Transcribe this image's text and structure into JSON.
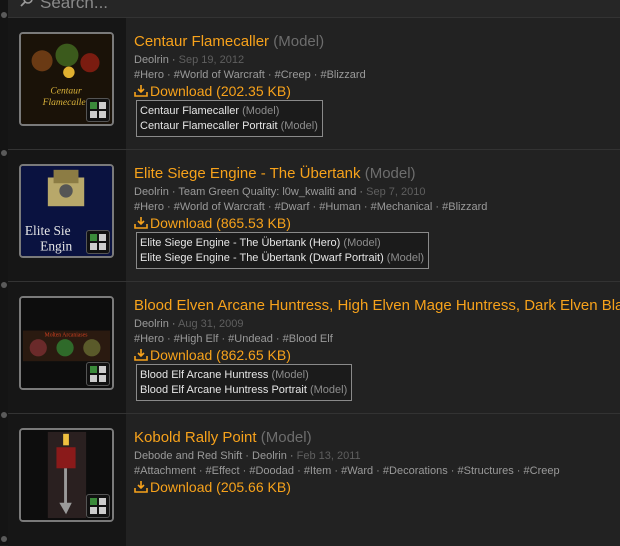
{
  "search": {
    "placeholder": "Search..."
  },
  "resources": [
    {
      "title": "Centaur Flamecaller",
      "type_label": "(Model)",
      "authors": "Deolrin",
      "date": "Sep 19, 2012",
      "tags": [
        "#Hero",
        "#World of Warcraft",
        "#Creep",
        "#Blizzard"
      ],
      "download_label": "Download (202.35 KB)",
      "thumb_text": [
        "Centaur",
        "Flamecaller"
      ],
      "files": [
        {
          "name": "Centaur Flamecaller",
          "type": "(Model)"
        },
        {
          "name": "Centaur Flamecaller Portrait",
          "type": "(Model)"
        }
      ]
    },
    {
      "title": "Elite Siege Engine - The Übertank",
      "type_label": "(Model)",
      "authors": "Deolrin · Team Green Quality: l0w_kwaliti and",
      "date": "Sep 7, 2010",
      "tags": [
        "#Hero",
        "#World of Warcraft",
        "#Dwarf",
        "#Human",
        "#Mechanical",
        "#Blizzard"
      ],
      "download_label": "Download (865.53 KB)",
      "thumb_text": [
        "Elite Sie",
        "Engin"
      ],
      "files": [
        {
          "name": "Elite Siege Engine - The Übertank (Hero)",
          "type": "(Model)"
        },
        {
          "name": "Elite Siege Engine - The Übertank (Dwarf Portrait)",
          "type": "(Model)"
        }
      ]
    },
    {
      "title": "Blood Elven Arcane Huntress, High Elven Mage Huntress, Dark Elven Blade",
      "type_label": "",
      "authors": "Deolrin",
      "date": "Aug 31, 2009",
      "tags": [
        "#Hero",
        "#High Elf",
        "#Undead",
        "#Blood Elf"
      ],
      "download_label": "Download (862.65 KB)",
      "thumb_text": [
        "Molten Arcaniases"
      ],
      "files": [
        {
          "name": "Blood Elf Arcane Huntress",
          "type": "(Model)"
        },
        {
          "name": "Blood Elf Arcane Huntress Portrait",
          "type": "(Model)"
        }
      ]
    },
    {
      "title": "Kobold Rally Point",
      "type_label": "(Model)",
      "authors": "Debode and Red Shift · Deolrin",
      "date": "Feb 13, 2011",
      "tags": [
        "#Attachment",
        "#Effect",
        "#Doodad",
        "#Item",
        "#Ward",
        "#Decorations",
        "#Structures",
        "#Creep"
      ],
      "download_label": "Download (205.66 KB)",
      "thumb_text": [],
      "files": []
    }
  ],
  "colors": {
    "accent": "#f7a21b",
    "muted": "#6d6d6d",
    "background": "#1d1d1d"
  }
}
